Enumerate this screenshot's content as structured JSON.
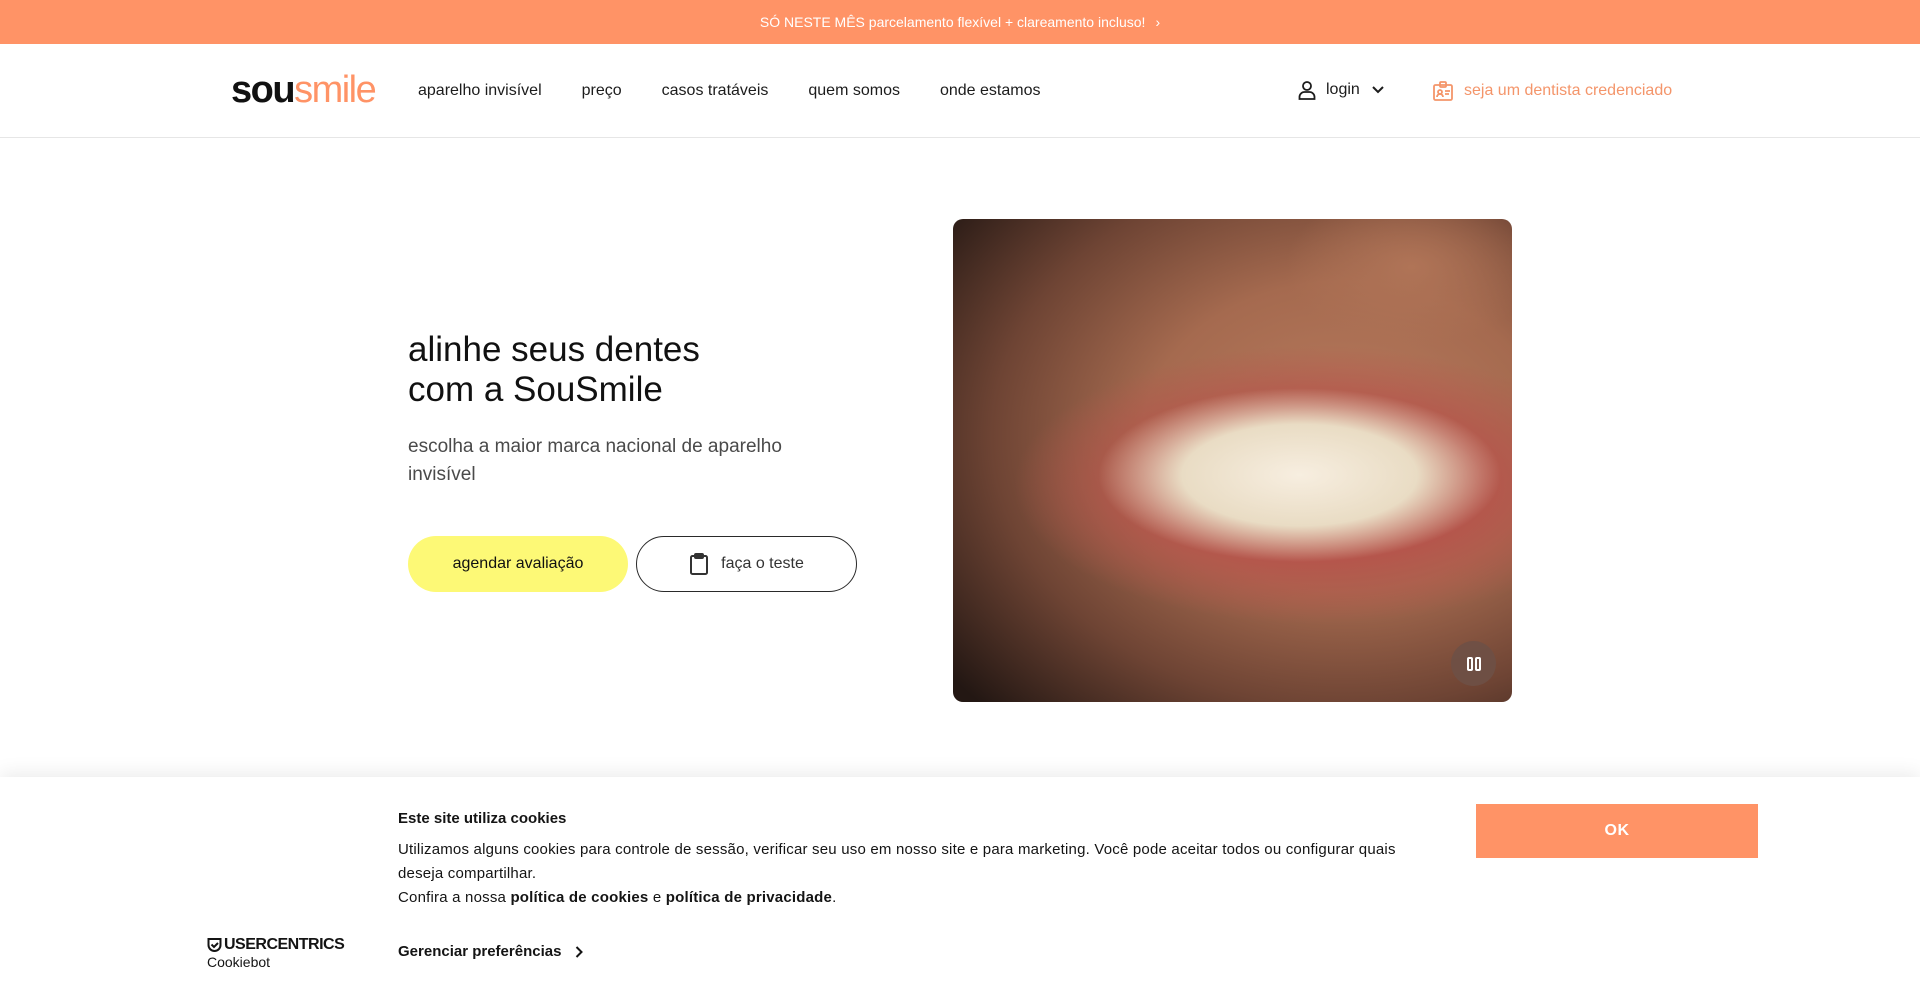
{
  "promo": {
    "text": "SÓ NESTE MÊS parcelamento flexível + clareamento incluso!",
    "chevron": "›"
  },
  "header": {
    "logo_sou": "sou",
    "logo_smile": "smile",
    "nav": [
      {
        "label": "aparelho invisível"
      },
      {
        "label": "preço"
      },
      {
        "label": "casos tratáveis"
      },
      {
        "label": "quem somos"
      },
      {
        "label": "onde estamos"
      }
    ],
    "login_label": "login",
    "dentist_label": "seja um dentista credenciado"
  },
  "hero": {
    "title_line1": "alinhe seus dentes",
    "title_line2": "com a SouSmile",
    "subtitle": "escolha a maior marca nacional de aparelho invisível",
    "primary_button": "agendar avaliação",
    "secondary_button": "faça o teste"
  },
  "cookie": {
    "title": "Este site utiliza cookies",
    "text_line1": "Utilizamos alguns cookies para controle de sessão, verificar seu uso em nosso site e para marketing. Você pode aceitar todos ou configurar quais deseja compartilhar.",
    "text_prefix": "Confira a nossa ",
    "link_cookies": "política de cookies",
    "text_and": " e ",
    "link_privacy": "política de privacidade",
    "text_suffix": ".",
    "manage_label": "Gerenciar preferências",
    "ok_label": "OK",
    "brand": "USERCENTRICS",
    "brand_sub": "Cookiebot"
  },
  "colors": {
    "accent": "#ff9366",
    "primary_button": "#fdf976",
    "dentist_link": "#f4956a"
  },
  "icons": [
    "user-icon",
    "chevron-down-icon",
    "id-card-icon",
    "clipboard-icon",
    "pause-icon",
    "shield-icon",
    "chevron-right-icon"
  ]
}
